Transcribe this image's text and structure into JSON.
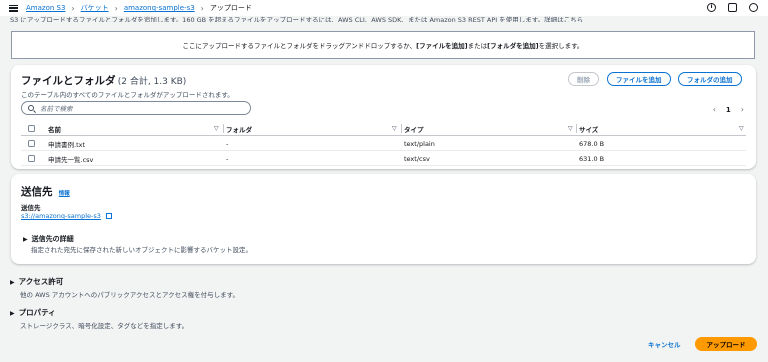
{
  "breadcrumb": {
    "items": [
      "Amazon S3",
      "バケット",
      "amazonq-sample-s3"
    ],
    "current": "アップロード"
  },
  "info_line": "S3 にアップロードするファイルとフォルダを追加します。160 GB を超えるファイルをアップロードするには、AWS CLI、AWS SDK、または Amazon S3 REST API を使用します。詳細はこちら",
  "dropzone": {
    "pre": "ここにアップロードするファイルとフォルダをドラッグアンドドロップするか、",
    "add_files": "[ファイルを追加]",
    "mid": " または ",
    "add_folder": "[フォルダを追加]",
    "post": " を選択します。"
  },
  "files_panel": {
    "title": "ファイルとフォルダ",
    "count": "(2 合計, 1.3 KB)",
    "description": "このテーブル内のすべてのファイルとフォルダがアップロードされます。",
    "delete_button": "削除",
    "add_files_button": "ファイルを追加",
    "add_folder_button": "フォルダの追加",
    "search_placeholder": "名前で検索",
    "page": "1",
    "columns": [
      "名前",
      "フォルダ",
      "タイプ",
      "サイズ"
    ],
    "rows": [
      {
        "name": "申請書例.txt",
        "folder": "-",
        "type": "text/plain",
        "size": "678.0 B"
      },
      {
        "name": "申請先一覧.csv",
        "folder": "-",
        "type": "text/csv",
        "size": "631.0 B"
      }
    ]
  },
  "destination": {
    "title": "送信先",
    "info": "情報",
    "label": "送信先",
    "link": "s3://amazonq-sample-s3",
    "details_title": "送信先の詳細",
    "details_desc": "指定された宛先に保存された新しいオブジェクトに影響するバケット設定。"
  },
  "access": {
    "title": "アクセス許可",
    "desc": "他の AWS アカウントへのパブリックアクセスとアクセス権を付与します。"
  },
  "properties": {
    "title": "プロパティ",
    "desc": "ストレージクラス、暗号化設定、タグなどを指定します。"
  },
  "footer": {
    "cancel": "キャンセル",
    "upload": "アップロード"
  },
  "colors": {
    "accent": "#0972d3",
    "primary": "#ff9900"
  }
}
